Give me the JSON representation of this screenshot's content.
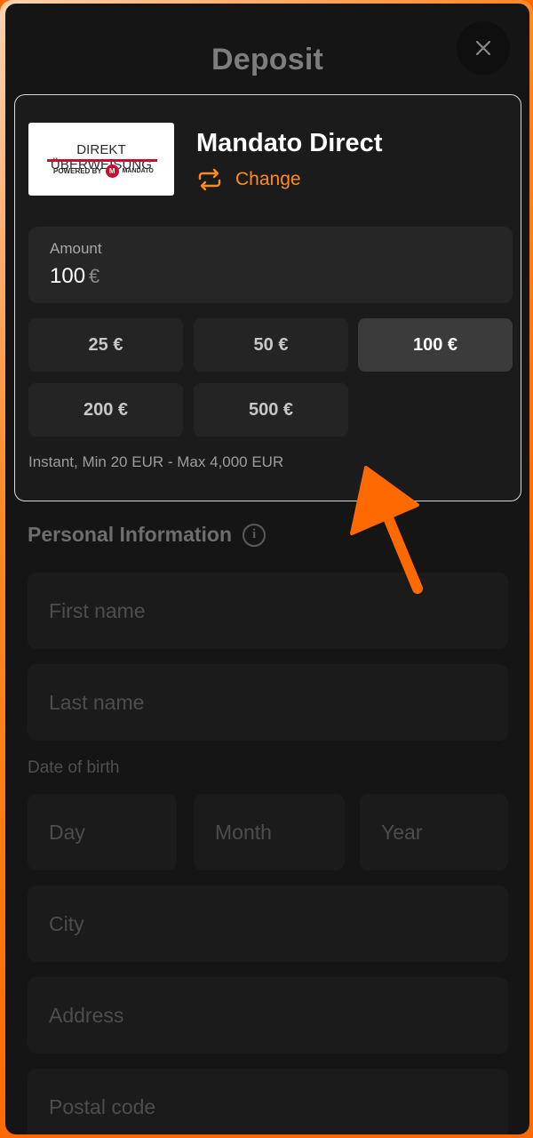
{
  "colors": {
    "accent": "#ff6a00",
    "change_link": "#ff8c1a",
    "modal_bg": "#151515",
    "card_bg": "#1b1b1b",
    "active_preset_bg": "#3b3b3b"
  },
  "header": {
    "title": "Deposit",
    "close_icon": "close-icon"
  },
  "payment_method": {
    "logo_text": "DIREKT ÜBERWEISUNG",
    "logo_powered": "POWERED BY",
    "logo_mark": "M",
    "logo_brand": "MANDATO",
    "name": "Mandato Direct",
    "change_label": "Change",
    "change_icon": "swap-arrows-icon"
  },
  "amount": {
    "label": "Amount",
    "value": "100",
    "currency": "€",
    "presets": [
      {
        "label": "25 €",
        "active": false
      },
      {
        "label": "50 €",
        "active": false
      },
      {
        "label": "100 €",
        "active": true
      },
      {
        "label": "200 €",
        "active": false
      },
      {
        "label": "500 €",
        "active": false
      }
    ],
    "limits": "Instant, Min 20 EUR - Max 4,000 EUR"
  },
  "personal_info": {
    "title": "Personal Information",
    "info_icon": "info-icon",
    "first_name_placeholder": "First name",
    "last_name_placeholder": "Last name",
    "dob_label": "Date of birth",
    "day_placeholder": "Day",
    "month_placeholder": "Month",
    "year_placeholder": "Year",
    "city_placeholder": "City",
    "address_placeholder": "Address",
    "postal_code_placeholder": "Postal code"
  }
}
